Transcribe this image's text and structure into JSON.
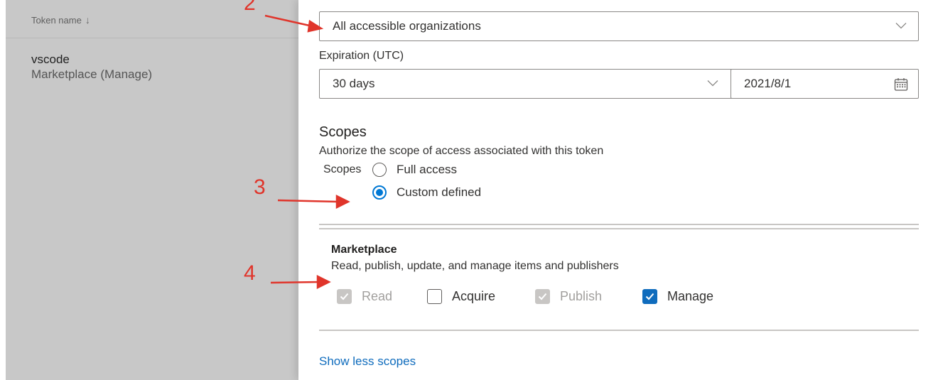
{
  "list": {
    "column_header": "Token name",
    "sort_icon": "arrow-down-icon",
    "token": {
      "name": "vscode",
      "scope": "Marketplace (Manage)"
    }
  },
  "form": {
    "organization": {
      "value": "All accessible organizations"
    },
    "expiration": {
      "label": "Expiration (UTC)",
      "duration_value": "30 days",
      "date_value": "2021/8/1"
    },
    "scopes": {
      "title": "Scopes",
      "description": "Authorize the scope of access associated with this token",
      "group_label": "Scopes",
      "options": [
        {
          "label": "Full access",
          "selected": false
        },
        {
          "label": "Custom defined",
          "selected": true
        }
      ]
    },
    "marketplace": {
      "title": "Marketplace",
      "description": "Read, publish, update, and manage items and publishers",
      "permissions": [
        {
          "label": "Read",
          "checked": true,
          "disabled": true
        },
        {
          "label": "Acquire",
          "checked": false,
          "disabled": false
        },
        {
          "label": "Publish",
          "checked": true,
          "disabled": true
        },
        {
          "label": "Manage",
          "checked": true,
          "disabled": false
        }
      ]
    },
    "show_less_link": "Show less scopes"
  },
  "annotations": {
    "step_2": "2",
    "step_3": "3",
    "step_4": "4",
    "color": "#e0352b"
  },
  "colors": {
    "accent": "#0f6cbd",
    "radio_accent": "#0078d4",
    "dimmed_background": "#c8c8c8"
  }
}
